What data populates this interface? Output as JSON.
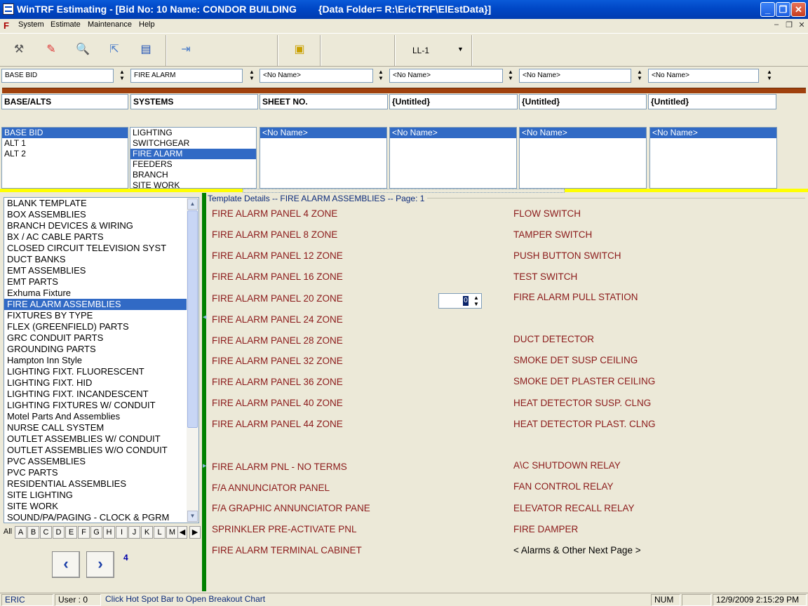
{
  "window": {
    "title": "WinTRF Estimating - [Bid No: 10 Name: CONDOR BUILDING        {Data Folder= R:\\EricTRF\\ElEstData}]"
  },
  "menu": [
    "System",
    "Estimate",
    "Maintenance",
    "Help"
  ],
  "toolbar": {
    "ll_label": "LL-1"
  },
  "combos": [
    "BASE BID",
    "FIRE ALARM",
    "<No Name>",
    "<No Name>",
    "<No Name>",
    "<No Name>"
  ],
  "headers": [
    "BASE/ALTS",
    "SYSTEMS",
    "SHEET NO.",
    "{Untitled}",
    "{Untitled}",
    "{Untitled}"
  ],
  "lists": {
    "bases": [
      "BASE BID",
      "ALT 1",
      "ALT 2"
    ],
    "systems": [
      "LIGHTING",
      "SWITCHGEAR",
      "FIRE ALARM",
      "FEEDERS",
      "BRANCH",
      "SITE WORK"
    ],
    "sheet": [
      "<No Name>"
    ],
    "u1": [
      "<No Name>"
    ],
    "u2": [
      "<No Name>"
    ],
    "u3": [
      "<No Name>"
    ]
  },
  "assemblies": [
    "BLANK TEMPLATE",
    "BOX ASSEMBLIES",
    "BRANCH DEVICES & WIRING",
    "BX / AC CABLE PARTS",
    "CLOSED CIRCUIT TELEVISION SYST",
    "DUCT BANKS",
    "EMT ASSEMBLIES",
    "EMT PARTS",
    "Exhuma Fixture",
    "FIRE ALARM ASSEMBLIES",
    "FIXTURES BY TYPE",
    "FLEX (GREENFIELD) PARTS",
    "GRC CONDUIT PARTS",
    "GROUNDING PARTS",
    "Hampton Inn Style",
    "LIGHTING FIXT. FLUORESCENT",
    "LIGHTING FIXT. HID",
    "LIGHTING FIXT. INCANDESCENT",
    "LIGHTING FIXTURES W/ CONDUIT",
    "Motel Parts And Assemblies",
    "NURSE CALL SYSTEM",
    "OUTLET ASSEMBLIES W/ CONDUIT",
    "OUTLET ASSEMBLIES W/O CONDUIT",
    "PVC ASSEMBLIES",
    "PVC PARTS",
    "RESIDENTIAL ASSEMBLIES",
    "SITE LIGHTING",
    "SITE WORK",
    "SOUND/PA/PAGING - CLOCK & PGRM"
  ],
  "alpha": [
    "All",
    "A",
    "B",
    "C",
    "D",
    "E",
    "F",
    "G",
    "H",
    "I",
    "J",
    "K",
    "L",
    "M"
  ],
  "page_number": "4",
  "detail_title": "Template Details  -- FIRE ALARM ASSEMBLIES -- Page: 1",
  "left_items": [
    "FIRE ALARM PANEL 4 ZONE",
    "FIRE ALARM PANEL 8 ZONE",
    "FIRE ALARM PANEL 12 ZONE",
    "FIRE ALARM PANEL 16 ZONE",
    "FIRE ALARM PANEL 20 ZONE",
    "FIRE ALARM PANEL 24 ZONE",
    "FIRE ALARM PANEL 28 ZONE",
    "FIRE ALARM PANEL 32 ZONE",
    "FIRE ALARM PANEL 36 ZONE",
    "FIRE ALARM PANEL 40 ZONE",
    "FIRE ALARM PANEL 44 ZONE",
    "FIRE ALARM PNL - NO TERMS",
    "F/A ANNUNCIATOR PANEL",
    "F/A GRAPHIC ANNUNCIATOR PANE",
    "SPRINKLER PRE-ACTIVATE PNL",
    "FIRE ALARM TERMINAL CABINET"
  ],
  "right_items": [
    "FLOW SWITCH",
    "TAMPER SWITCH",
    "PUSH BUTTON SWITCH",
    "TEST SWITCH",
    "FIRE ALARM PULL STATION",
    "DUCT DETECTOR",
    "SMOKE DET SUSP CEILING",
    "SMOKE DET PLASTER CEILING",
    "HEAT DETECTOR SUSP. CLNG",
    "HEAT DETECTOR PLAST. CLNG",
    "A\\C SHUTDOWN RELAY",
    "FAN CONTROL RELAY",
    "ELEVATOR RECALL RELAY",
    "FIRE DAMPER",
    "< Alarms & Other Next Page >"
  ],
  "qty_value": "0",
  "status": {
    "user_name": "ERIC",
    "user_field": "User : 0",
    "hint": "Click Hot Spot Bar to Open Breakout Chart",
    "num": "NUM",
    "datetime": "12/9/2009 2:15:29 PM"
  }
}
